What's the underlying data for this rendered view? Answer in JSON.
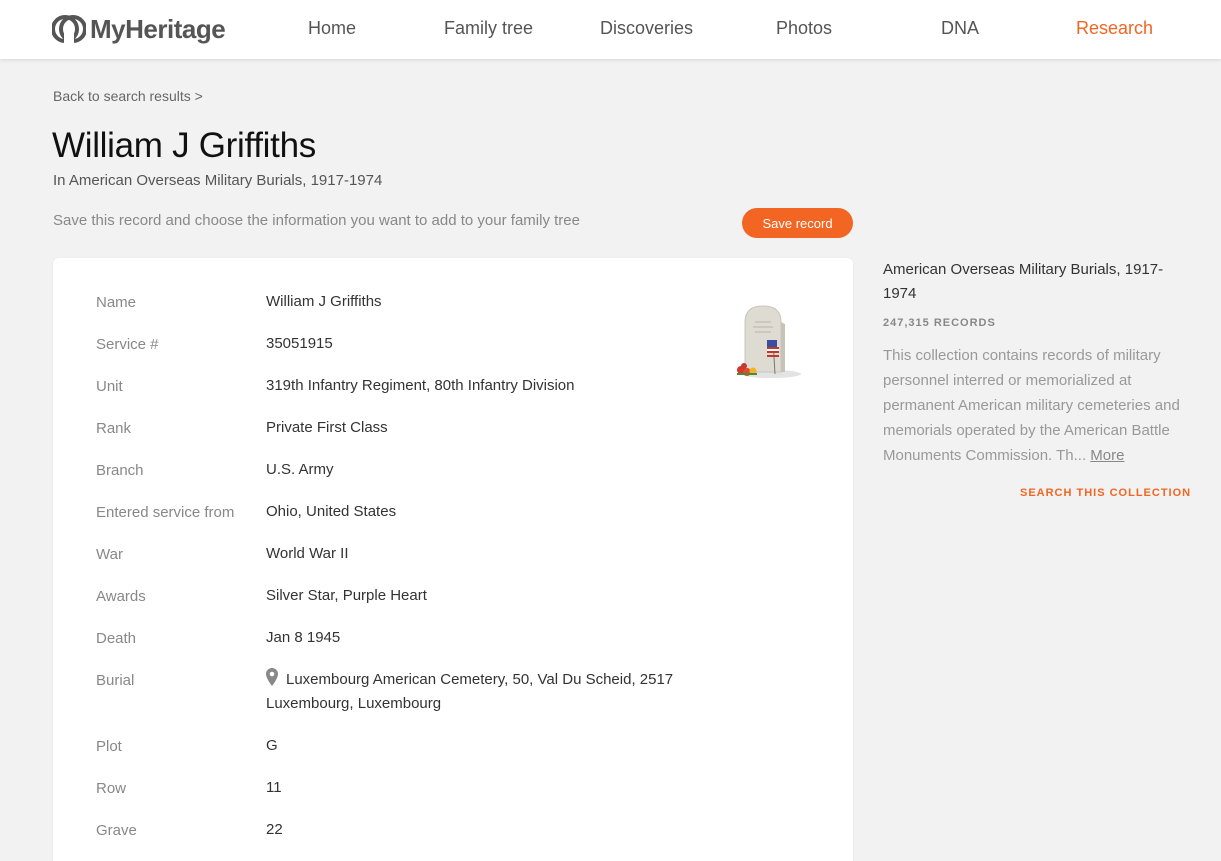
{
  "header": {
    "logo_text": "MyHeritage",
    "nav": [
      {
        "label": "Home"
      },
      {
        "label": "Family tree"
      },
      {
        "label": "Discoveries"
      },
      {
        "label": "Photos"
      },
      {
        "label": "DNA"
      },
      {
        "label": "Research"
      }
    ],
    "active_nav": "Research",
    "accent_color": "#f26522"
  },
  "breadcrumb": "Back to search results >",
  "record": {
    "title": "William J Griffiths",
    "collection_subtitle": "In American Overseas Military Burials, 1917-1974",
    "save_hint": "Save this record and choose the information you want to add to your family tree",
    "save_button": "Save record",
    "fields": [
      {
        "label": "Name",
        "value": "William J Griffiths"
      },
      {
        "label": "Service #",
        "value": "35051915"
      },
      {
        "label": "Unit",
        "value": "319th Infantry Regiment, 80th Infantry Division"
      },
      {
        "label": "Rank",
        "value": "Private First Class"
      },
      {
        "label": "Branch",
        "value": "U.S. Army"
      },
      {
        "label": "Entered service from",
        "value": "Ohio, United States"
      },
      {
        "label": "War",
        "value": "World War II"
      },
      {
        "label": "Awards",
        "value": "Silver Star, Purple Heart"
      },
      {
        "label": "Death",
        "value": "Jan 8 1945"
      },
      {
        "label": "Burial",
        "value": "Luxembourg American Cemetery, 50, Val Du Scheid, 2517 Luxembourg, Luxembourg"
      },
      {
        "label": "Plot",
        "value": "G"
      },
      {
        "label": "Row",
        "value": "11"
      },
      {
        "label": "Grave",
        "value": "22"
      }
    ]
  },
  "sidebar": {
    "collection_title": "American Overseas Military Burials, 1917-1974",
    "record_count": "247,315 RECORDS",
    "description": "This collection contains records of military personnel interred or memorialized at permanent American military cemeteries and memorials operated by the American Battle Monuments Commission. Th...",
    "more_link": "More",
    "search_link": "SEARCH THIS COLLECTION"
  }
}
